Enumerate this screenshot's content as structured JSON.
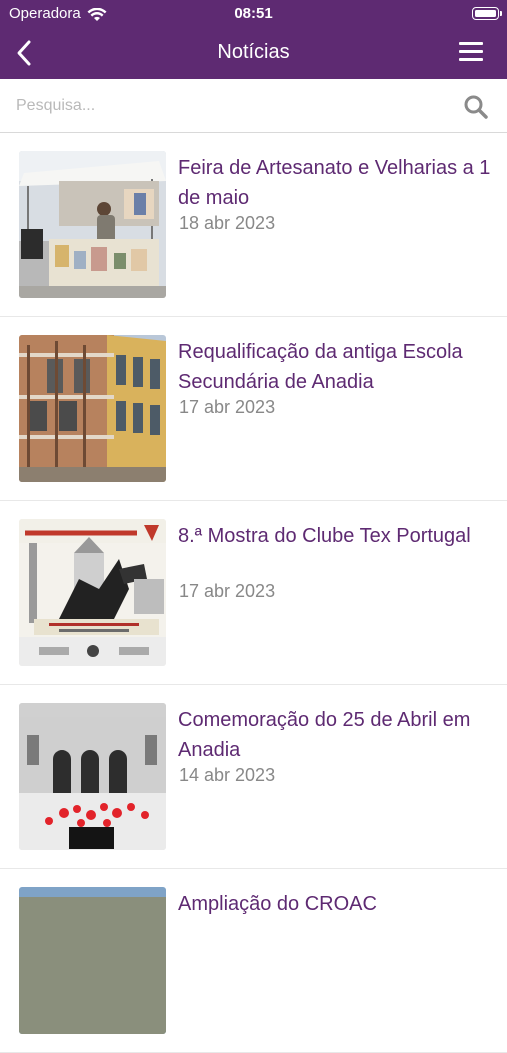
{
  "status_bar": {
    "carrier": "Operadora",
    "time": "08:51"
  },
  "header": {
    "title": "Notícias",
    "back_icon": "chevron-left-icon",
    "menu_icon": "hamburger-menu-icon"
  },
  "search": {
    "placeholder": "Pesquisa...",
    "value": "",
    "icon": "search-icon"
  },
  "colors": {
    "brand": "#5e2a72",
    "date": "#888888"
  },
  "news": [
    {
      "title": "Feira de Artesanato e Velharias a 1 de maio",
      "date": "18 abr 2023"
    },
    {
      "title": "Requalificação da antiga Escola Secundária de Anadia",
      "date": "17 abr 2023"
    },
    {
      "title": "8.ª Mostra do Clube Tex Portugal",
      "date": "17 abr 2023"
    },
    {
      "title": "Comemoração do 25 de Abril em Anadia",
      "date": "14 abr 2023"
    },
    {
      "title": "Ampliação do CROAC",
      "date": ""
    }
  ]
}
